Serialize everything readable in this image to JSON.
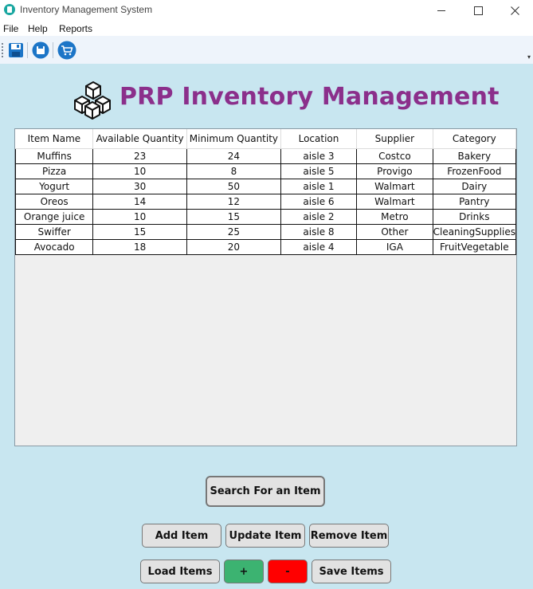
{
  "window": {
    "title": "Inventory Management System"
  },
  "menu": [
    {
      "label": "File"
    },
    {
      "label": "Help"
    },
    {
      "label": "Reports"
    }
  ],
  "toolbar": {
    "buttons": [
      {
        "icon": "save-disk-icon"
      },
      {
        "icon": "save-circle-icon"
      },
      {
        "icon": "shopping-cart-icon"
      }
    ]
  },
  "header": {
    "title": "PRP Inventory Management",
    "logo_icon": "boxes-icon"
  },
  "table": {
    "columns": [
      "Item Name",
      "Available Quantity",
      "Minimum Quantity",
      "Location",
      "Supplier",
      "Category"
    ],
    "rows": [
      [
        "Muffins",
        "23",
        "24",
        "aisle 3",
        "Costco",
        "Bakery"
      ],
      [
        "Pizza",
        "10",
        "8",
        "aisle 5",
        "Provigo",
        "FrozenFood"
      ],
      [
        "Yogurt",
        "30",
        "50",
        "aisle 1",
        "Walmart",
        "Dairy"
      ],
      [
        "Oreos",
        "14",
        "12",
        "aisle 6",
        "Walmart",
        "Pantry"
      ],
      [
        "Orange juice",
        "10",
        "15",
        "aisle 2",
        "Metro",
        "Drinks"
      ],
      [
        "Swiffer",
        "15",
        "25",
        "aisle 8",
        "Other",
        "CleaningSupplies"
      ],
      [
        "Avocado",
        "18",
        "20",
        "aisle 4",
        "IGA",
        "FruitVegetable"
      ]
    ]
  },
  "buttons": {
    "search": "Search For an Item",
    "add": "Add Item",
    "update": "Update Item",
    "remove": "Remove Item",
    "load": "Load Items",
    "plus": "+",
    "minus": "-",
    "save": "Save Items"
  },
  "colors": {
    "background": "#c8e6f0",
    "title": "#8b2f8b",
    "plus_button": "#3cb371",
    "minus_button": "#ff0000",
    "toolbar_icon": "#1c75c7"
  }
}
